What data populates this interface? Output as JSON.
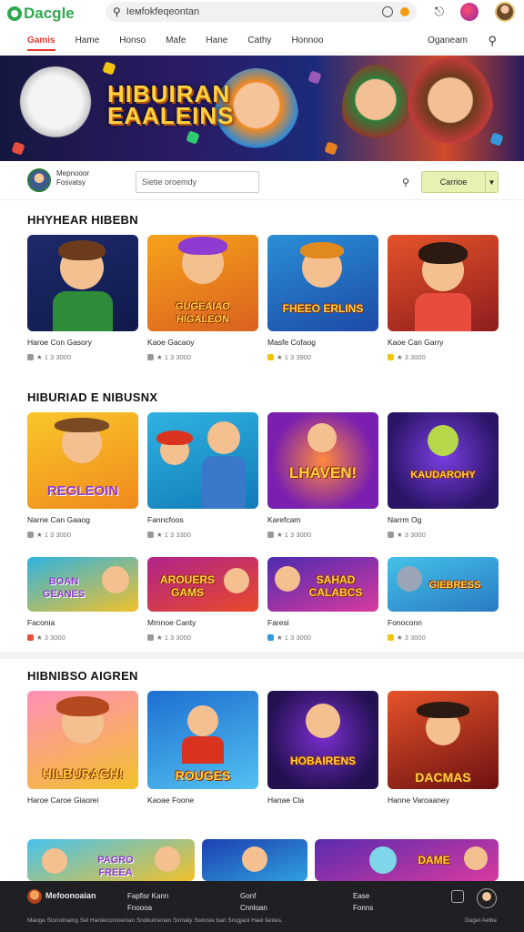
{
  "header": {
    "logo_text": "Dacgle",
    "search_value": "Iемfokfeqeontan",
    "colors": {
      "logo": "#2fa84f",
      "accent": "#e53935"
    }
  },
  "nav": {
    "items": [
      "Gamis",
      "Hame",
      "Honso",
      "Mafe",
      "Hane",
      "Cathy",
      "Honnoo"
    ],
    "right_label": "Oganeam"
  },
  "banner": {
    "title_line1": "HIBUIRAN",
    "title_line2": "EAALEINS"
  },
  "filter": {
    "name_line1": "Mepnooor",
    "name_line2": "Fosvatsy",
    "input_placeholder": "Sietie oroemdy",
    "button_label": "Carrioe"
  },
  "sections": [
    {
      "title": "HHYHEAR HIBEBN",
      "cards": [
        {
          "name": "Haroe Con Gasory",
          "meta": "★ 1 3 3000",
          "tag": ""
        },
        {
          "name": "Kaoe Gacaoy",
          "meta": "★ 1 3 3000",
          "tag": "GUGEAIAO HIGALEON"
        },
        {
          "name": "Masfe Cofaog",
          "meta": "★ 1 3 3900",
          "tag": "FHEEO ERLINS"
        },
        {
          "name": "Kaoe Can Garry",
          "meta": "★ 3 3000",
          "tag": ""
        }
      ]
    },
    {
      "title": "HIBURIAD E NIBUSNX",
      "cards": [
        {
          "name": "Narne Can Gaaog",
          "meta": "★ 1 3 3000",
          "tag": "REGLEOIN"
        },
        {
          "name": "Fanncfoos",
          "meta": "★ 1 3 3300",
          "tag": ""
        },
        {
          "name": "Karefcam",
          "meta": "★ 1 3 3000",
          "tag": "LHAVEN!"
        },
        {
          "name": "Narrm Og",
          "meta": "★ 3 3000",
          "tag": "KAUDAROHY"
        }
      ],
      "cards2": [
        {
          "name": "Faconia",
          "meta": "★ 3 3000",
          "tag": "BOAN GEANES"
        },
        {
          "name": "Mrnnoe Canty",
          "meta": "★ 1 3 3000",
          "tag": "AROUERS GAMS"
        },
        {
          "name": "Faresi",
          "meta": "★ 1 3 3000",
          "tag": "SAHAD CALABCS"
        },
        {
          "name": "Fonoconn",
          "meta": "★ 3 3000",
          "tag": "GIEBRESS"
        }
      ]
    },
    {
      "title": "HIBNIBSO AIGREN",
      "cards": [
        {
          "name": "Haroe Caroe Giaorei",
          "meta": "",
          "tag": "HILBURAGH!"
        },
        {
          "name": "Kaoae Foone",
          "meta": "",
          "tag": "ROUGES"
        },
        {
          "name": "Hanae Cla",
          "meta": "",
          "tag": "HOBAIRENS"
        },
        {
          "name": "Hanne Varoaaney",
          "meta": "",
          "tag": "DACMAS"
        }
      ],
      "cards2": [
        {
          "name": "",
          "meta": "",
          "tag": "PAGRO FREEA"
        },
        {
          "name": "",
          "meta": "",
          "tag": ""
        },
        {
          "name": "",
          "meta": "",
          "tag": "DAME"
        }
      ]
    }
  ],
  "footer": {
    "brand": "Mefoonoaian",
    "col1": [
      "Fapfisr Kann",
      "Fnoooa"
    ],
    "col2": [
      "Gonf",
      "Cnnloan"
    ],
    "col3": [
      "Ease",
      "Fonns"
    ],
    "legal": "Maoge Slonotnaing Sel Hardeconinenian Sndkutnenan Sxmaly Swtosie ban Srogjaol Haei fantes.",
    "legal_right": "Dagel Aelbe"
  }
}
